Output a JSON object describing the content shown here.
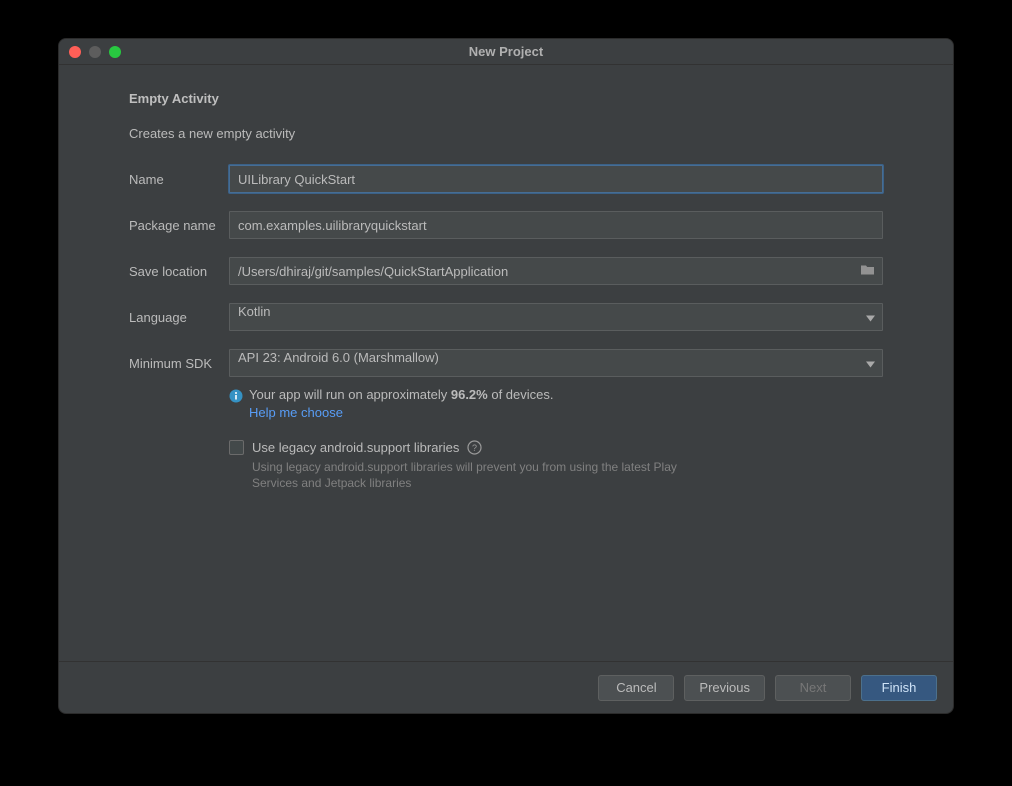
{
  "window": {
    "title": "New Project"
  },
  "header": {
    "title": "Empty Activity",
    "description": "Creates a new empty activity"
  },
  "form": {
    "name_label": "Name",
    "name_value": "UILibrary QuickStart",
    "package_label": "Package name",
    "package_value": "com.examples.uilibraryquickstart",
    "save_location_label": "Save location",
    "save_location_value": "/Users/dhiraj/git/samples/QuickStartApplication",
    "language_label": "Language",
    "language_value": "Kotlin",
    "min_sdk_label": "Minimum SDK",
    "min_sdk_value": "API 23: Android 6.0 (Marshmallow)"
  },
  "info": {
    "text_pre": "Your app will run on approximately ",
    "percent": "96.2%",
    "text_post": " of devices.",
    "help_link": "Help me choose"
  },
  "legacy": {
    "checkbox_label": "Use legacy android.support libraries",
    "hint": "Using legacy android.support libraries will prevent you from using the latest Play Services and Jetpack libraries"
  },
  "footer": {
    "cancel": "Cancel",
    "previous": "Previous",
    "next": "Next",
    "finish": "Finish"
  }
}
